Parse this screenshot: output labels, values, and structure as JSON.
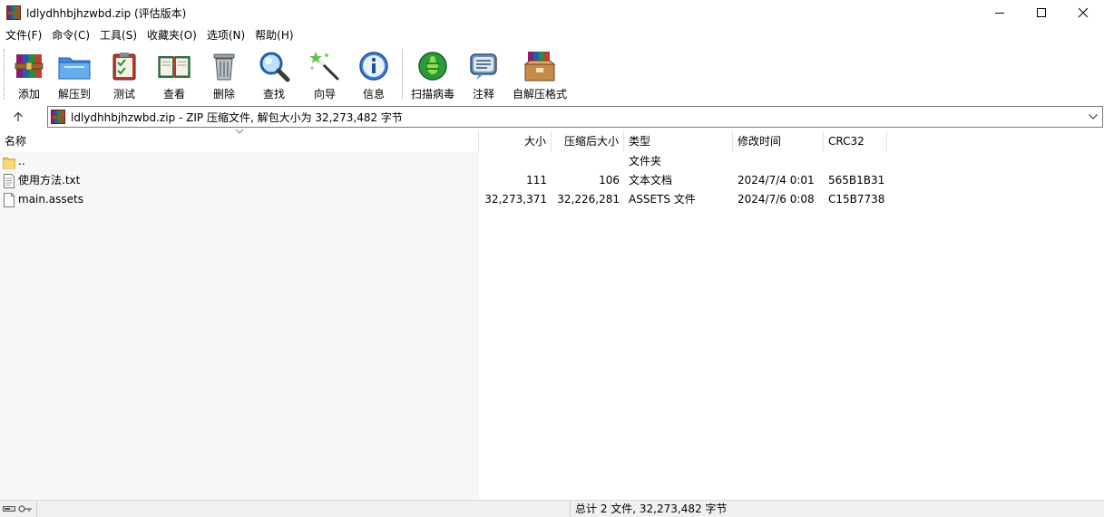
{
  "window": {
    "title": "ldlydhhbjhzwbd.zip (评估版本)",
    "controls": [
      "minimize-icon",
      "maximize-icon",
      "close-icon"
    ]
  },
  "menu": {
    "items": [
      "文件(F)",
      "命令(C)",
      "工具(S)",
      "收藏夹(O)",
      "选项(N)",
      "帮助(H)"
    ]
  },
  "toolbar": {
    "buttons": [
      {
        "label": "添加",
        "icon": "add-archive-icon"
      },
      {
        "label": "解压到",
        "icon": "extract-folder-icon"
      },
      {
        "label": "测试",
        "icon": "test-clipboard-icon"
      },
      {
        "label": "查看",
        "icon": "view-book-icon"
      },
      {
        "label": "删除",
        "icon": "trash-icon"
      },
      {
        "label": "查找",
        "icon": "magnifier-icon"
      },
      {
        "label": "向导",
        "icon": "wizard-wand-icon"
      },
      {
        "label": "信息",
        "icon": "info-icon"
      },
      {
        "label": "扫描病毒",
        "icon": "virus-scan-icon"
      },
      {
        "label": "注释",
        "icon": "comment-icon"
      },
      {
        "label": "自解压格式",
        "icon": "sfx-box-icon"
      }
    ]
  },
  "address": {
    "text": "ldlydhhbjhzwbd.zip - ZIP 压缩文件, 解包大小为 32,273,482 字节"
  },
  "columns": {
    "name": "名称",
    "size": "大小",
    "packed": "压缩后大小",
    "type": "类型",
    "modified": "修改时间",
    "crc": "CRC32"
  },
  "rows": [
    {
      "name": "..",
      "size": "",
      "packed": "",
      "type": "文件夹",
      "modified": "",
      "crc": "",
      "icon": "folder-icon"
    },
    {
      "name": "使用方法.txt",
      "size": "111",
      "packed": "106",
      "type": "文本文档",
      "modified": "2024/7/4 0:01",
      "crc": "565B1B31",
      "icon": "text-file-icon"
    },
    {
      "name": "main.assets",
      "size": "32,273,371",
      "packed": "32,226,281",
      "type": "ASSETS 文件",
      "modified": "2024/7/6 0:08",
      "crc": "C15B7738",
      "icon": "file-icon"
    }
  ],
  "status": {
    "summary": "总计 2 文件, 32,273,482 字节"
  },
  "colors": {
    "list_left_bg": "#f7f7f7",
    "statusbar_bg": "#f0f0f0"
  }
}
